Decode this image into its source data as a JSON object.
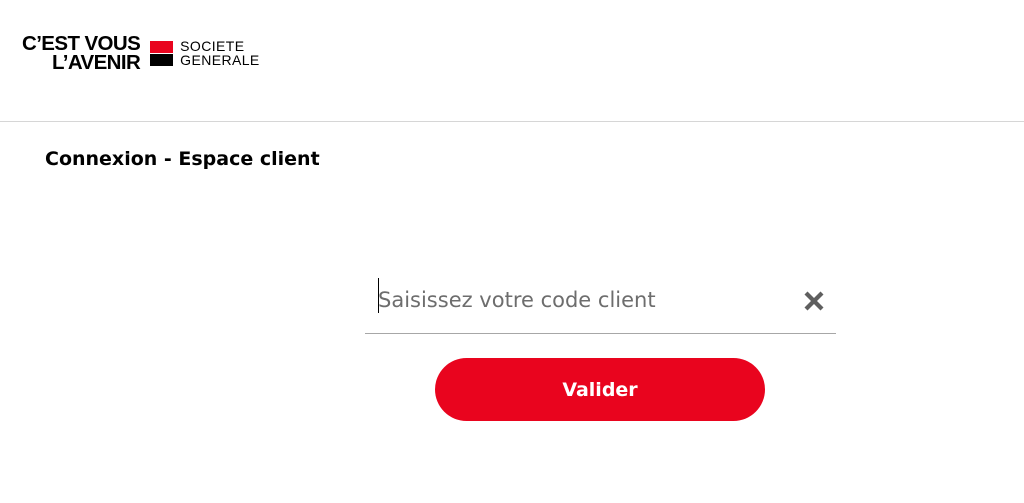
{
  "header": {
    "slogan_line1": "C’EST VOUS",
    "slogan_line2": "L’AVENIR",
    "brand_line1": "SOCIETE",
    "brand_line2": "GENERALE",
    "logo_icon": "societe-generale-square-icon"
  },
  "page": {
    "title": "Connexion - Espace client"
  },
  "login": {
    "input_value": "",
    "input_placeholder": "Saisissez votre code client",
    "clear_icon": "close-icon",
    "submit_label": "Valider"
  },
  "colors": {
    "brand_red": "#e9041e",
    "text": "#000000",
    "placeholder": "#6d6d6d",
    "divider": "#d6d6d6",
    "clear_icon": "#5f5f5f"
  }
}
